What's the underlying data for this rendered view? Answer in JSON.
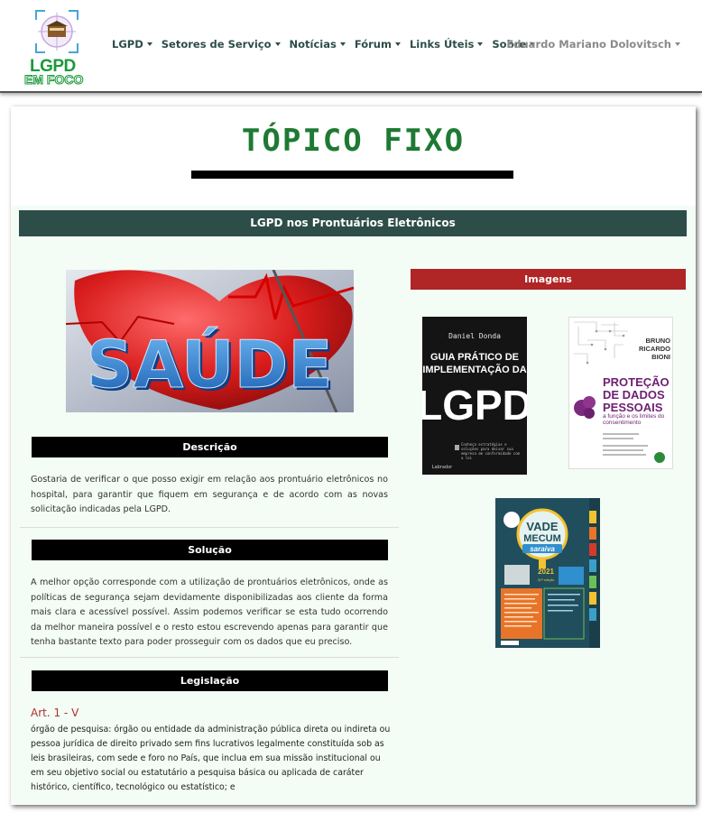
{
  "logo": {
    "line1": "LGPD",
    "line2": "EM FOCO"
  },
  "nav": {
    "items": [
      {
        "label": "LGPD"
      },
      {
        "label": "Setores de Serviço"
      },
      {
        "label": "Notícias"
      },
      {
        "label": "Fórum"
      },
      {
        "label": "Links Úteis"
      },
      {
        "label": "Sobre"
      }
    ],
    "user": "Eduardo Mariano Dolovitsch"
  },
  "page": {
    "title": "TÓPICO FIXO",
    "topic": "LGPD nos Prontuários Eletrônicos",
    "hero_text": "SAÚDE",
    "description": {
      "heading": "Descrição",
      "text": "Gostaria de verificar o que posso exigir em relação aos prontuário eletrônicos no hospital, para garantir que fiquem em segurança e de acordo com as novas solicitação indicadas pela LGPD."
    },
    "solution": {
      "heading": "Solução",
      "text": "A melhor opção corresponde com a utilização de prontuários eletrônicos, onde as políticas de segurança sejam devidamente disponibilizadas aos cliente da forma mais clara e acessível possível. Assim podemos verificar se esta tudo ocorrendo da melhor maneira possível e o resto estou escrevendo apenas para garantir que tenha bastante texto para poder prosseguir com os dados que eu preciso."
    },
    "legislation": {
      "heading": "Legislação",
      "article": "Art. 1 - V",
      "text": "órgão de pesquisa: órgão ou entidade da administração pública direta ou indireta ou pessoa jurídica de direito privado sem fins lucrativos legalmente constituída sob as leis brasileiras, com sede e foro no País, que inclua em sua missão institucional ou em seu objetivo social ou estatutário a pesquisa básica ou aplicada de caráter histórico, científico, tecnológico ou estatístico; e"
    },
    "images": {
      "heading": "Imagens",
      "book1": {
        "author": "Daniel Donda",
        "title1": "GUIA PRÁTICO DE",
        "title2": "IMPLEMENTAÇÃO DA",
        "title3": "LGPD",
        "blurb": "Conheça estratégias e soluções para deixar sua empresa em conformidade com a lei",
        "publisher": "Labrador"
      },
      "book2": {
        "author1": "BRUNO",
        "author2": "RICARDO",
        "author3": "BIONI",
        "title1": "PROTEÇÃO",
        "title2": "DE DADOS",
        "title3": "PESSOAIS",
        "subtitle": "a função e os limites do consentimento"
      },
      "book3": {
        "title1": "VADE",
        "title2": "MECUM",
        "brand": "saraiva",
        "year": "2021",
        "edition": "31ª edição"
      }
    }
  },
  "colors": {
    "dark_teal": "#2d4d48",
    "title_green": "#1e7a33",
    "image_red": "#b02525",
    "panel_bg": "#f3fcf5",
    "article_red": "#b03030"
  }
}
